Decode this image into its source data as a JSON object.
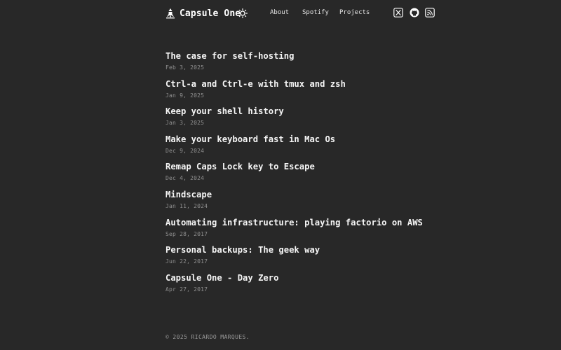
{
  "header": {
    "brand": "Capsule One",
    "brand_icon": "rocket-icon",
    "theme_icon": "sun-icon",
    "nav": [
      {
        "label": "About"
      },
      {
        "label": "Spotify"
      },
      {
        "label": "Projects"
      }
    ],
    "social": [
      {
        "icon": "x-icon"
      },
      {
        "icon": "github-icon"
      },
      {
        "icon": "rss-icon"
      }
    ]
  },
  "posts": [
    {
      "title": "The case for self-hosting",
      "date": "Feb 3, 2025"
    },
    {
      "title": "Ctrl-a and Ctrl-e with tmux and zsh",
      "date": "Jan 9, 2025"
    },
    {
      "title": "Keep your shell history",
      "date": "Jan 3, 2025"
    },
    {
      "title": "Make your keyboard fast in Mac Os",
      "date": "Dec 9, 2024"
    },
    {
      "title": "Remap Caps Lock key to Escape",
      "date": "Dec 4, 2024"
    },
    {
      "title": "Mindscape",
      "date": "Jan 11, 2024"
    },
    {
      "title": "Automating infrastructure: playing factorio on AWS",
      "date": "Sep 28, 2017"
    },
    {
      "title": "Personal backups: The geek way",
      "date": "Jun 22, 2017"
    },
    {
      "title": "Capsule One - Day Zero",
      "date": "Apr 27, 2017"
    }
  ],
  "footer": {
    "copyright": "© 2025 RICARDO MARQUES."
  },
  "colors": {
    "background": "#282828",
    "text": "#ececec",
    "muted": "#8f8f8f"
  }
}
